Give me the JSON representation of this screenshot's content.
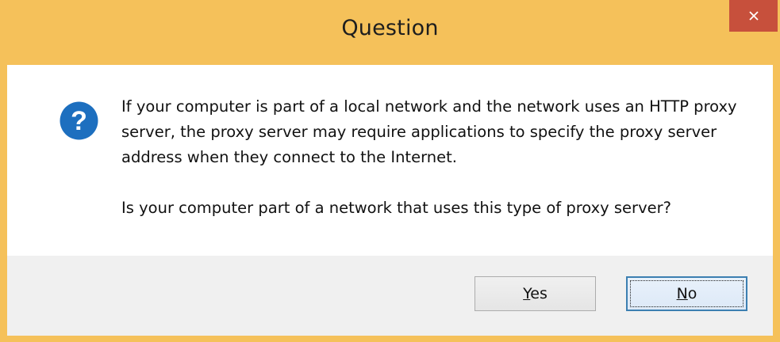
{
  "dialog": {
    "title": "Question",
    "close_icon": "close-icon",
    "icon": "question-icon",
    "message_paragraphs": [
      "If your computer is part of a local network and the network uses an HTTP proxy server, the proxy server may require applications to specify the proxy server address when they connect to the Internet.",
      "Is your computer part of a network that uses this type of proxy server?"
    ],
    "buttons": {
      "yes": {
        "mnemonic": "Y",
        "rest": "es"
      },
      "no": {
        "mnemonic": "N",
        "rest": "o",
        "focused": true
      }
    }
  },
  "colors": {
    "titlebar": "#f5c15a",
    "close_button": "#c7503c",
    "icon_blue": "#1d6fbf",
    "button_area": "#f0f0f0",
    "focus_border": "#3c7fb1"
  }
}
